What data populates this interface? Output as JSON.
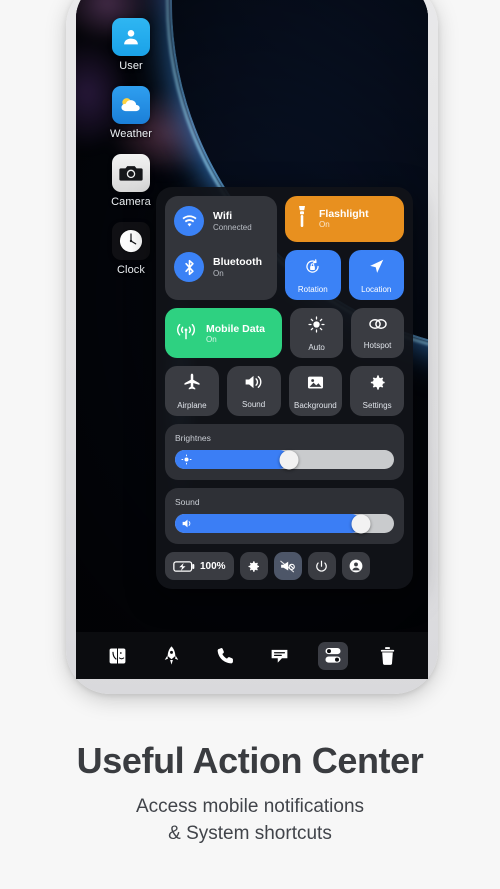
{
  "promo": {
    "title": "Useful Action Center",
    "subtitle_line1": "Access mobile notifications",
    "subtitle_line2": "& System shortcuts"
  },
  "home_apps": [
    {
      "label": "User",
      "icon": "user-icon"
    },
    {
      "label": "Weather",
      "icon": "weather-icon"
    },
    {
      "label": "Camera",
      "icon": "camera-icon"
    },
    {
      "label": "Clock",
      "icon": "clock-icon"
    }
  ],
  "control_center": {
    "connectivity": [
      {
        "title": "Wifi",
        "status": "Connected",
        "icon": "wifi-icon"
      },
      {
        "title": "Bluetooth",
        "status": "On",
        "icon": "bluetooth-icon"
      }
    ],
    "flashlight": {
      "title": "Flashlight",
      "status": "On",
      "icon": "flashlight-icon",
      "color": "#e8901f"
    },
    "mobile_data": {
      "title": "Mobile Data",
      "status": "On",
      "icon": "mobile-data-icon",
      "color": "#2ed181"
    },
    "tiles": [
      {
        "label": "Rotation",
        "icon": "rotation-lock-icon",
        "active": true,
        "color": "#3b82f6"
      },
      {
        "label": "Location",
        "icon": "location-arrow-icon",
        "active": true,
        "color": "#3b82f6"
      },
      {
        "label": "Auto",
        "icon": "brightness-auto-icon",
        "active": false,
        "color": "#3a3c42"
      },
      {
        "label": "Hotspot",
        "icon": "hotspot-icon",
        "active": false,
        "color": "#3a3c42"
      },
      {
        "label": "Airplane",
        "icon": "airplane-icon",
        "active": false,
        "color": "#3a3c42"
      },
      {
        "label": "Sound",
        "icon": "speaker-icon",
        "active": false,
        "color": "#3a3c42"
      },
      {
        "label": "Background",
        "icon": "image-icon",
        "active": false,
        "color": "#3a3c42"
      },
      {
        "label": "Settings",
        "icon": "gear-icon",
        "active": false,
        "color": "#3a3c42"
      }
    ],
    "sliders": [
      {
        "label": "Brightnes",
        "value": 52,
        "icon": "brightness-icon"
      },
      {
        "label": "Sound",
        "value": 85,
        "icon": "volume-icon"
      }
    ],
    "actions": {
      "battery_percent": "100%",
      "battery_icon": "battery-charging-icon",
      "buttons": [
        {
          "icon": "gear-icon",
          "highlighted": false
        },
        {
          "icon": "megaphone-mute-icon",
          "highlighted": true
        },
        {
          "icon": "power-icon",
          "highlighted": false
        },
        {
          "icon": "account-icon",
          "highlighted": false
        }
      ]
    }
  },
  "dock": [
    {
      "icon": "finder-icon",
      "active": false
    },
    {
      "icon": "rocket-icon",
      "active": false
    },
    {
      "icon": "phone-icon",
      "active": false
    },
    {
      "icon": "message-icon",
      "active": false
    },
    {
      "icon": "toggles-icon",
      "active": true
    },
    {
      "icon": "trash-icon",
      "active": false
    }
  ]
}
